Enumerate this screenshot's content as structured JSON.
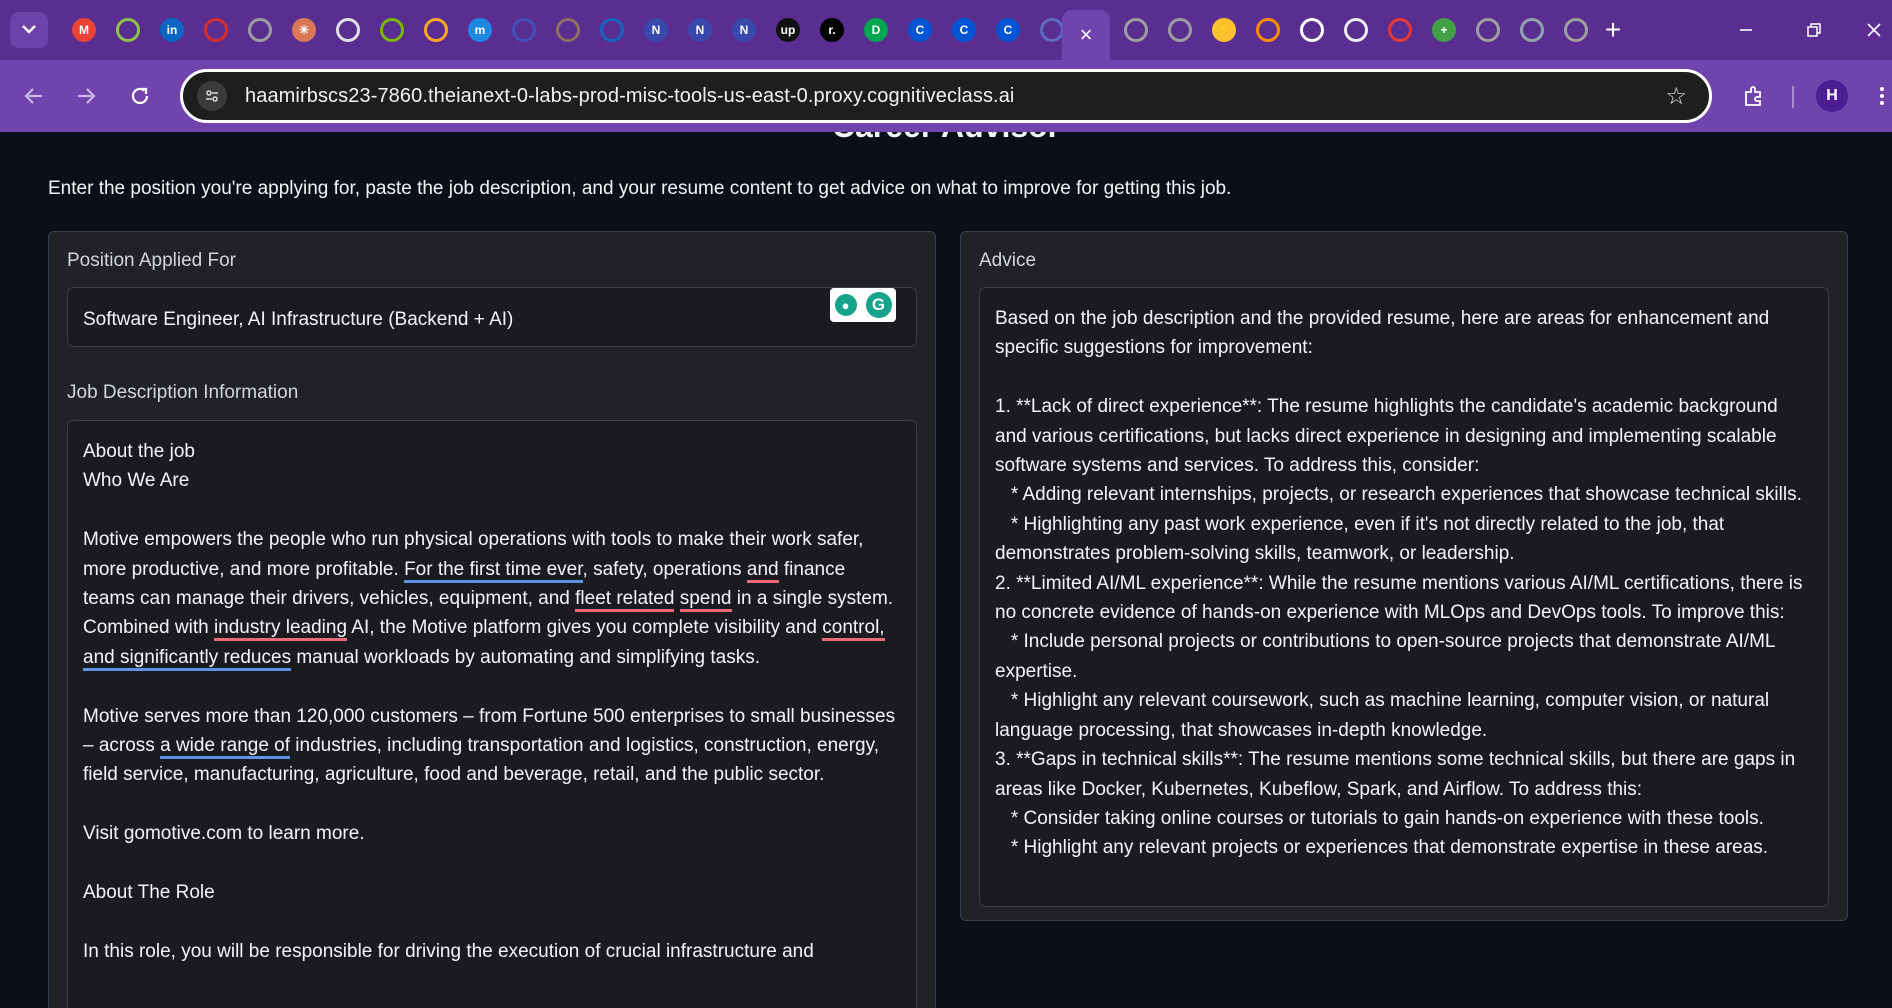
{
  "browser": {
    "url": "haamirbscs23-7860.theianext-0-labs-prod-misc-tools-us-east-0.proxy.cognitiveclass.ai",
    "tabs_left": [
      {
        "icon": "gmail-icon",
        "glyph": "M",
        "color": "#ea4335"
      },
      {
        "icon": "green-circle-icon",
        "glyph": "",
        "color": "#8bc34a"
      },
      {
        "icon": "linkedin-icon",
        "glyph": "in",
        "color": "#0a66c2"
      },
      {
        "icon": "red-globe-icon",
        "glyph": "",
        "color": "#d32f2f"
      },
      {
        "icon": "globe-icon",
        "glyph": "",
        "color": "#9e9e9e"
      },
      {
        "icon": "claude-icon",
        "glyph": "✳",
        "color": "#d97757"
      },
      {
        "icon": "openai-icon",
        "glyph": "",
        "color": "#e0e0e0"
      },
      {
        "icon": "nvidia-icon",
        "glyph": "",
        "color": "#76b900"
      },
      {
        "icon": "settings-orange-icon",
        "glyph": "",
        "color": "#f9a825"
      },
      {
        "icon": "m-circle-icon",
        "glyph": "m",
        "color": "#1e88e5"
      },
      {
        "icon": "blue-ring-icon",
        "glyph": "",
        "color": "#3f51b5"
      },
      {
        "icon": "circle-icon",
        "glyph": "",
        "color": "#8d6e63"
      },
      {
        "icon": "graduation-icon",
        "glyph": "",
        "color": "#1565c0"
      },
      {
        "icon": "notion-n-icon",
        "glyph": "N",
        "color": "#3949ab"
      },
      {
        "icon": "notion-n-icon",
        "glyph": "N",
        "color": "#3949ab"
      },
      {
        "icon": "notion-n-icon",
        "glyph": "N",
        "color": "#3949ab"
      },
      {
        "icon": "upwork-icon",
        "glyph": "up",
        "color": "#111111"
      },
      {
        "icon": "r-icon",
        "glyph": "r.",
        "color": "#000000"
      },
      {
        "icon": "dk-icon",
        "glyph": "D",
        "color": "#00a650"
      },
      {
        "icon": "coursera-icon",
        "glyph": "C",
        "color": "#0056d2"
      },
      {
        "icon": "coursera-icon",
        "glyph": "C",
        "color": "#0056d2"
      },
      {
        "icon": "coursera-icon",
        "glyph": "C",
        "color": "#0056d2"
      },
      {
        "icon": "blue-ring-icon",
        "glyph": "",
        "color": "#5c6bc0"
      }
    ],
    "active_tab_close": "×",
    "tabs_right": [
      {
        "icon": "globe-icon",
        "glyph": "",
        "color": "#9e9e9e"
      },
      {
        "icon": "globe-icon",
        "glyph": "",
        "color": "#9e9e9e"
      },
      {
        "icon": "lightning-icon",
        "glyph": "⚡",
        "color": "#fbc02d"
      },
      {
        "icon": "cloud-icon",
        "glyph": "",
        "color": "#fb8c00"
      },
      {
        "icon": "github-icon",
        "glyph": "",
        "color": "#ffffff"
      },
      {
        "icon": "extension-icon",
        "glyph": "",
        "color": "#eeeeee"
      },
      {
        "icon": "gear-red-icon",
        "glyph": "",
        "color": "#e53935"
      },
      {
        "icon": "plus-green-icon",
        "glyph": "+",
        "color": "#43a047"
      },
      {
        "icon": "globe-icon",
        "glyph": "",
        "color": "#9e9e9e"
      },
      {
        "icon": "window-icon",
        "glyph": "",
        "color": "#90a4ae"
      },
      {
        "icon": "globe-icon",
        "glyph": "",
        "color": "#9e9e9e"
      }
    ],
    "new_tab": "+",
    "avatar_initial": "H"
  },
  "page": {
    "title": "Career Advisor",
    "instructions": "Enter the position you're applying for, paste the job description, and your resume content to get advice on what to improve for getting this job.",
    "position_label": "Position Applied For",
    "position_value": "Software Engineer, AI Infrastructure (Backend + AI)",
    "jd_label": "Job Description Information",
    "jd": {
      "p1_line1": "About the job",
      "p1_line2": "Who We Are",
      "p2_a": "Motive empowers the people who run physical operations with tools to make their work safer, more productive, and more profitable. ",
      "p2_b": "For the first time ever",
      "p2_c": ", safety, operations ",
      "p2_d": "and",
      "p2_e": " finance teams can manage their drivers, vehicles, equipment, and ",
      "p2_f": "fleet related",
      "p2_g": " ",
      "p2_h": "spend",
      "p2_i": " in a single system. Combined with ",
      "p2_j": "industry leading",
      "p2_k": " AI, the Motive platform gives you complete visibility and ",
      "p2_l": "control,",
      "p2_m": " ",
      "p2_n": "and significantly reduces",
      "p2_o": " manual workloads by automating and simplifying tasks.",
      "p3_a": "Motive serves more than 120,000 customers – from Fortune 500 enterprises to small businesses – across ",
      "p3_b": "a wide range of",
      "p3_c": " industries, including transportation and logistics, construction, energy, field service, manufacturing, agriculture, food and beverage, retail, and the public sector.",
      "p4": "Visit gomotive.com to learn more.",
      "p5": "About The Role",
      "p6": "In this role, you will be responsible for driving the execution of crucial infrastructure and"
    },
    "advice_label": "Advice",
    "advice_text": "Based on the job description and the provided resume, here are areas for enhancement and specific suggestions for improvement:\n\n1. **Lack of direct experience**: The resume highlights the candidate's academic background and various certifications, but lacks direct experience in designing and implementing scalable software systems and services. To address this, consider:\n   * Adding relevant internships, projects, or research experiences that showcase technical skills.\n   * Highlighting any past work experience, even if it's not directly related to the job, that demonstrates problem-solving skills, teamwork, or leadership.\n2. **Limited AI/ML experience**: While the resume mentions various AI/ML certifications, there is no concrete evidence of hands-on experience with MLOps and DevOps tools. To improve this:\n   * Include personal projects or contributions to open-source projects that demonstrate AI/ML expertise.\n   * Highlight any relevant coursework, such as machine learning, computer vision, or natural language processing, that showcases in-depth knowledge.\n3. **Gaps in technical skills**: The resume mentions some technical skills, but there are gaps in areas like Docker, Kubernetes, Kubeflow, Spark, and Airflow. To address this:\n   * Consider taking online courses or tutorials to gain hands-on experience with these tools.\n   * Highlight any relevant projects or experiences that demonstrate expertise in these areas."
  }
}
